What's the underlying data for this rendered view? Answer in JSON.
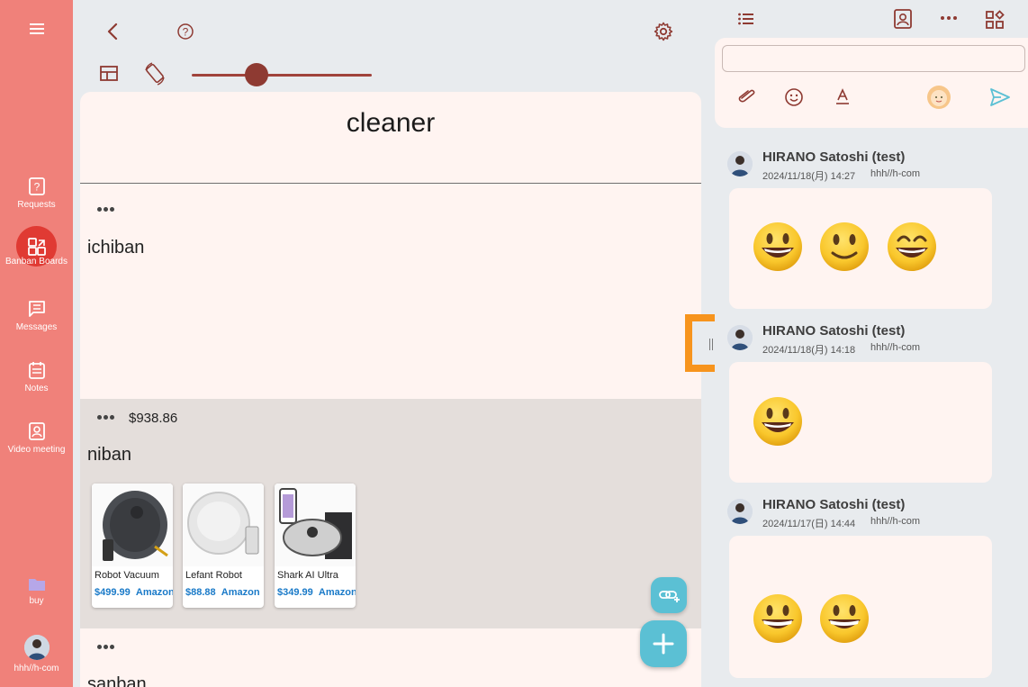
{
  "nav": {
    "items": [
      {
        "label": "Requests",
        "icon": "question-box-icon"
      },
      {
        "label": "Banban Boards",
        "icon": "boards-icon",
        "active": true
      },
      {
        "label": "Messages",
        "icon": "message-icon"
      },
      {
        "label": "Notes",
        "icon": "notes-icon"
      },
      {
        "label": "Video meeting",
        "icon": "video-meeting-icon"
      }
    ],
    "folder_label": "buy",
    "user_label": "hhh//h-com"
  },
  "toolbar": {
    "slider_value": 0.36
  },
  "board": {
    "title": "cleaner",
    "sections": [
      {
        "title": "ichiban",
        "price": ""
      },
      {
        "title": "niban",
        "price": "$938.86",
        "products": [
          {
            "name": "Robot Vacuum",
            "price": "$499.99",
            "store": "Amazon"
          },
          {
            "name": "Lefant Robot",
            "price": "$88.88",
            "store": "Amazon"
          },
          {
            "name": "Shark AI Ultra",
            "price": "$349.99",
            "store": "Amazon"
          }
        ]
      },
      {
        "title": "sanban",
        "price": ""
      }
    ]
  },
  "chat": {
    "input_value": "",
    "messages": [
      {
        "name": "HIRANO Satoshi (test)",
        "time": "2024/11/18(月) 14:27",
        "user": "hhh//h-com",
        "emojis": [
          "grin",
          "smile",
          "big-grin"
        ]
      },
      {
        "name": "HIRANO Satoshi (test)",
        "time": "2024/11/18(月) 14:18",
        "user": "hhh//h-com",
        "emojis": [
          "grin"
        ]
      },
      {
        "name": "HIRANO Satoshi (test)",
        "time": "2024/11/17(日) 14:44",
        "user": "hhh//h-com",
        "emojis": [
          "grinning",
          "grinning"
        ]
      }
    ]
  },
  "colors": {
    "nav_bg": "#f0817a",
    "nav_active": "#e03a33",
    "accent": "#8e3a32",
    "fab": "#5bc0d4",
    "highlight": "#f7941d"
  }
}
